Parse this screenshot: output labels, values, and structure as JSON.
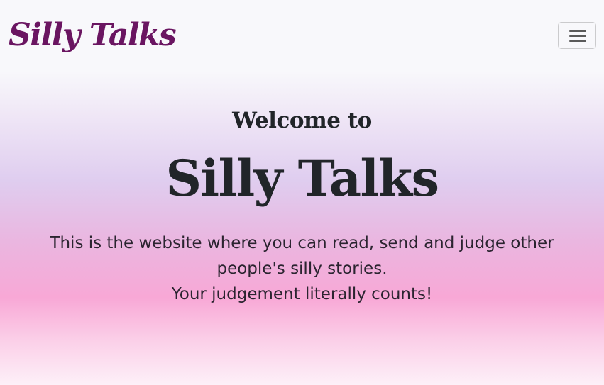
{
  "navbar": {
    "brand": "Silly Talks",
    "menu_icon": "hamburger-menu-icon"
  },
  "hero": {
    "welcome": "Welcome to",
    "title": "Silly Talks",
    "description": "This is the website where you can read, send and judge other people's silly stories.",
    "tagline": "Your judgement literally counts!"
  },
  "colors": {
    "brand": "#6a1561",
    "text": "#212529",
    "gradient_pink": "#f8a8d6",
    "gradient_lavender": "#dfcdef"
  }
}
